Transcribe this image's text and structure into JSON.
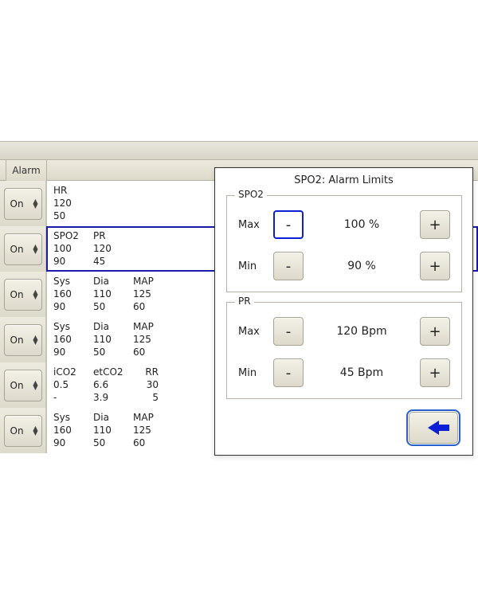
{
  "headers": {
    "alarm": "Alarm"
  },
  "on_label": "On",
  "rows": [
    {
      "type": "grid1",
      "labels": [
        "HR"
      ],
      "vals": [
        "120",
        "50"
      ]
    },
    {
      "type": "grid2",
      "selected": true,
      "labels": [
        "SPO2",
        "PR"
      ],
      "vals": [
        "100",
        "120",
        "90",
        "45"
      ]
    },
    {
      "type": "grid3",
      "labels": [
        "Sys",
        "Dia",
        "MAP"
      ],
      "vals": [
        "160",
        "110",
        "125",
        "90",
        "50",
        "60"
      ]
    },
    {
      "type": "grid3",
      "labels": [
        "Sys",
        "Dia",
        "MAP"
      ],
      "vals": [
        "160",
        "110",
        "125",
        "90",
        "50",
        "60"
      ]
    },
    {
      "type": "grid3",
      "labels": [
        "iCO2",
        "etCO2",
        "RR"
      ],
      "vals": [
        "0.5",
        "6.6",
        "30",
        "-",
        "3.9",
        "5"
      ],
      "right_align_cols": [
        2
      ]
    },
    {
      "type": "grid3",
      "labels": [
        "Sys",
        "Dia",
        "MAP"
      ],
      "vals": [
        "160",
        "110",
        "125",
        "90",
        "50",
        "60"
      ]
    }
  ],
  "dialog": {
    "title": "SPO2: Alarm Limits",
    "groups": [
      {
        "legend": "SPO2",
        "rows": [
          {
            "label": "Max",
            "value": "100 %",
            "minus_focused": true
          },
          {
            "label": "Min",
            "value": "90 %"
          }
        ]
      },
      {
        "legend": "PR",
        "rows": [
          {
            "label": "Max",
            "value": "120 Bpm"
          },
          {
            "label": "Min",
            "value": "45 Bpm"
          }
        ]
      }
    ],
    "minus": "-",
    "plus": "+"
  }
}
